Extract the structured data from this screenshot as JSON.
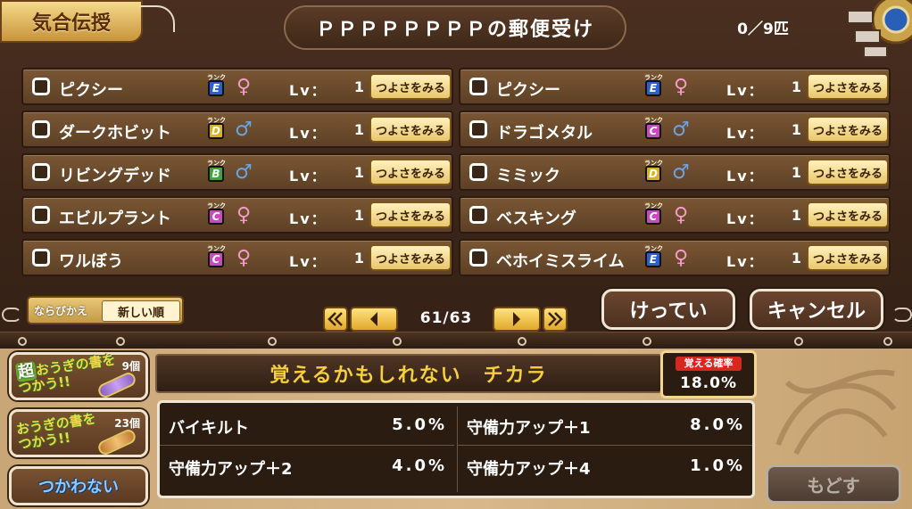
{
  "header": {
    "tab_label": "気合伝授",
    "title": "ＰＰＰＰＰＰＰＰの郵便受け",
    "count": "0／9匹"
  },
  "monsters": [
    {
      "name": "ピクシー",
      "rank": "E",
      "rank_color": "#2e5fd0",
      "gender": "♀",
      "lv_label": "Lv：",
      "lv": "1",
      "button": "つよさをみる"
    },
    {
      "name": "ピクシー",
      "rank": "E",
      "rank_color": "#2e5fd0",
      "gender": "♀",
      "lv_label": "Lv：",
      "lv": "1",
      "button": "つよさをみる"
    },
    {
      "name": "ダークホビット",
      "rank": "D",
      "rank_color": "#d9b21e",
      "gender": "♂",
      "lv_label": "Lv：",
      "lv": "1",
      "button": "つよさをみる"
    },
    {
      "name": "ドラゴメタル",
      "rank": "C",
      "rank_color": "#c84bbd",
      "gender": "♂",
      "lv_label": "Lv：",
      "lv": "1",
      "button": "つよさをみる"
    },
    {
      "name": "リビングデッド",
      "rank": "B",
      "rank_color": "#3fa53a",
      "gender": "♂",
      "lv_label": "Lv：",
      "lv": "1",
      "button": "つよさをみる"
    },
    {
      "name": "ミミック",
      "rank": "D",
      "rank_color": "#d9b21e",
      "gender": "♂",
      "lv_label": "Lv：",
      "lv": "1",
      "button": "つよさをみる"
    },
    {
      "name": "エビルプラント",
      "rank": "C",
      "rank_color": "#c84bbd",
      "gender": "♀",
      "lv_label": "Lv：",
      "lv": "1",
      "button": "つよさをみる"
    },
    {
      "name": "ベスキング",
      "rank": "C",
      "rank_color": "#c84bbd",
      "gender": "♀",
      "lv_label": "Lv：",
      "lv": "1",
      "button": "つよさをみる"
    },
    {
      "name": "ワルぼう",
      "rank": "C",
      "rank_color": "#c84bbd",
      "gender": "♀",
      "lv_label": "Lv：",
      "lv": "1",
      "button": "つよさをみる"
    },
    {
      "name": "ベホイミスライム",
      "rank": "E",
      "rank_color": "#2e5fd0",
      "gender": "♀",
      "lv_label": "Lv：",
      "lv": "1",
      "button": "つよさをみる"
    }
  ],
  "rank_tiny": "ランク",
  "sort": {
    "label": "ならびかえ",
    "value": "新しい順"
  },
  "pager": {
    "text": "61/63"
  },
  "actions": {
    "confirm": "けってい",
    "cancel": "キャンセル"
  },
  "scrolls": [
    {
      "line1": "おうぎの書を",
      "line2": "つかう!!",
      "prefix": "超",
      "count": "9個"
    },
    {
      "line1": "おうぎの書を",
      "line2": "つかう!!",
      "prefix": "",
      "count": "23個"
    }
  ],
  "not_use": "つかわない",
  "skills": {
    "title": "覚えるかもしれない　チカラ",
    "prob_label": "覚える確率",
    "prob_value": "18.0%",
    "items": [
      {
        "name": "バイキルト",
        "rate": "5.0%"
      },
      {
        "name": "守備力アップ＋1",
        "rate": "8.0%"
      },
      {
        "name": "守備力アップ＋2",
        "rate": "4.0%"
      },
      {
        "name": "守備力アップ＋4",
        "rate": "1.0%"
      }
    ]
  },
  "back": "もどす",
  "colors": {
    "female": "#f59acb",
    "male": "#6aa3e8",
    "gold": "#f6cf3c"
  },
  "icons": [
    "checkbox-icon",
    "female-icon",
    "male-icon",
    "rank-badge-icon",
    "page-first-icon",
    "page-prev-icon",
    "page-next-icon",
    "page-last-icon",
    "scroll-item-icon",
    "ornament-icon"
  ]
}
